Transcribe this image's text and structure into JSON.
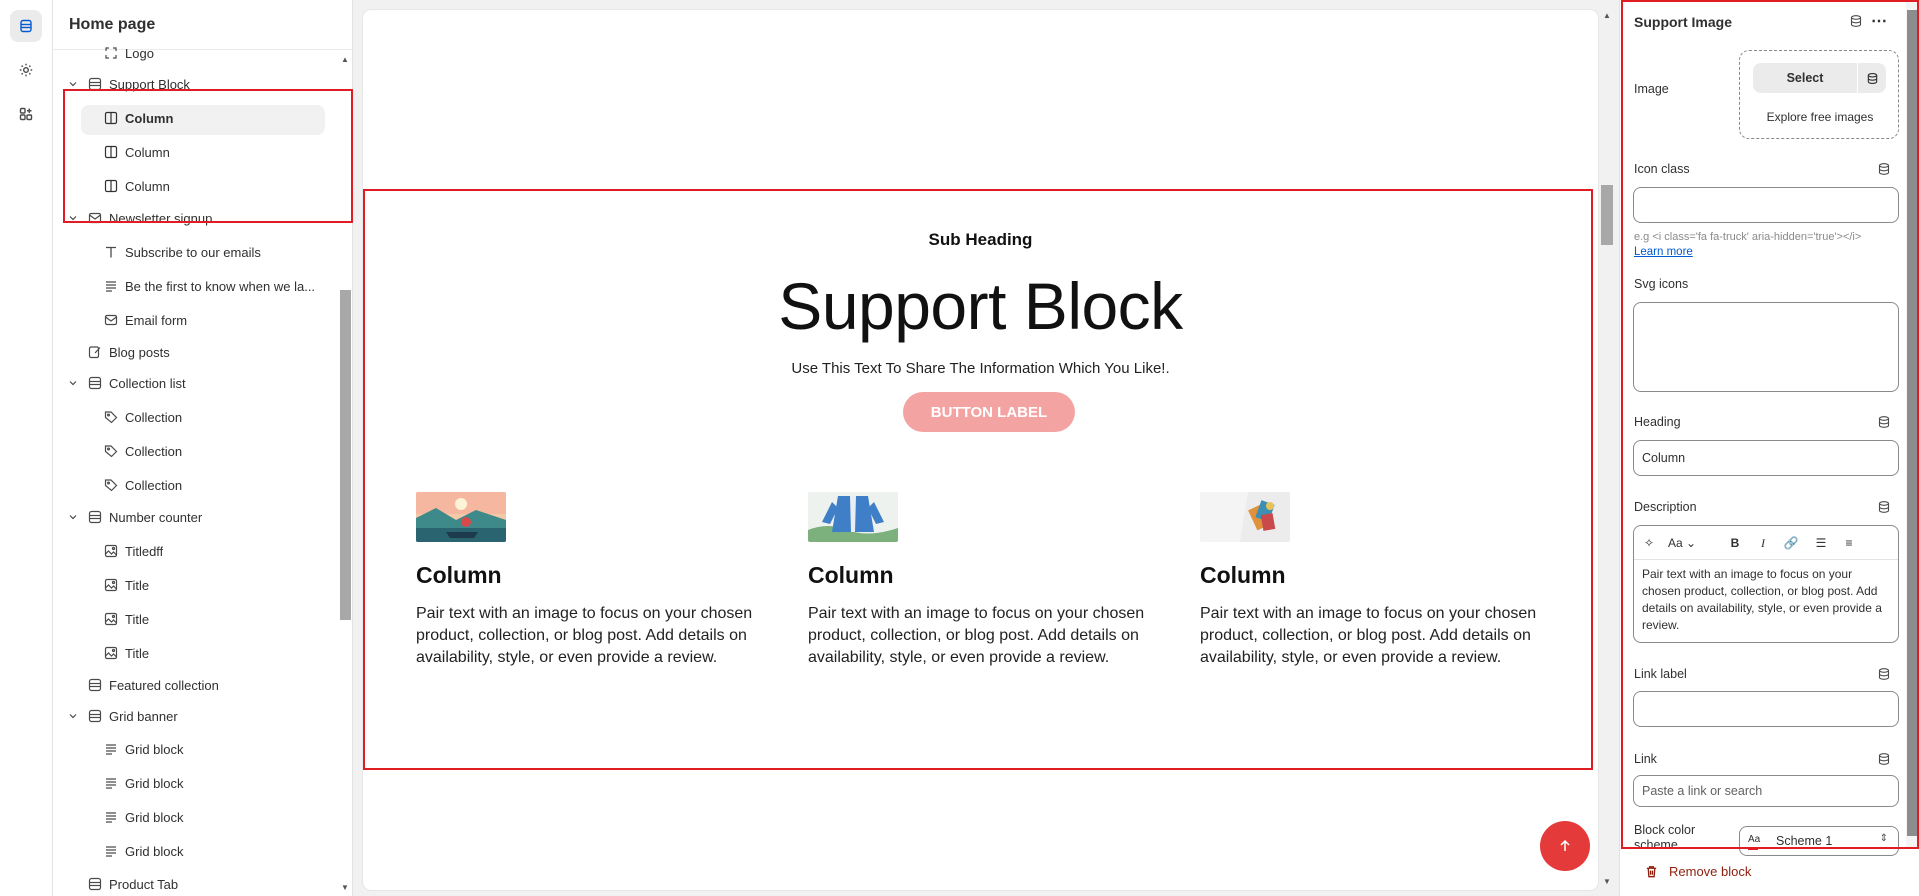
{
  "rail": {
    "items": [
      "sections-icon",
      "settings-icon",
      "apps-icon"
    ]
  },
  "sidebar": {
    "title": "Home page",
    "items": [
      {
        "label": "Logo",
        "level": 2,
        "icon": "logo-icon"
      },
      {
        "label": "Support Block",
        "level": 1,
        "icon": "section-icon",
        "expanded": true
      },
      {
        "label": "Column",
        "level": 2,
        "icon": "column-icon",
        "selected": true
      },
      {
        "label": "Column",
        "level": 2,
        "icon": "column-icon"
      },
      {
        "label": "Column",
        "level": 2,
        "icon": "column-icon"
      },
      {
        "label": "Newsletter signup",
        "level": 1,
        "icon": "email-icon",
        "expanded": true
      },
      {
        "label": "Subscribe to our emails",
        "level": 2,
        "icon": "text-icon"
      },
      {
        "label": "Be the first to know when we la...",
        "level": 2,
        "icon": "paragraph-icon"
      },
      {
        "label": "Email form",
        "level": 2,
        "icon": "email-icon"
      },
      {
        "label": "Blog posts",
        "level": 1,
        "icon": "blog-icon"
      },
      {
        "label": "Collection list",
        "level": 1,
        "icon": "section-icon",
        "expanded": true
      },
      {
        "label": "Collection",
        "level": 2,
        "icon": "tag-icon"
      },
      {
        "label": "Collection",
        "level": 2,
        "icon": "tag-icon"
      },
      {
        "label": "Collection",
        "level": 2,
        "icon": "tag-icon"
      },
      {
        "label": "Number counter",
        "level": 1,
        "icon": "section-icon",
        "expanded": true
      },
      {
        "label": "Titledff",
        "level": 2,
        "icon": "image-icon"
      },
      {
        "label": "Title",
        "level": 2,
        "icon": "image-icon"
      },
      {
        "label": "Title",
        "level": 2,
        "icon": "image-icon"
      },
      {
        "label": "Title",
        "level": 2,
        "icon": "image-icon"
      },
      {
        "label": "Featured collection",
        "level": 1,
        "icon": "section-icon"
      },
      {
        "label": "Grid banner",
        "level": 1,
        "icon": "section-icon",
        "expanded": true
      },
      {
        "label": "Grid block",
        "level": 2,
        "icon": "paragraph-icon"
      },
      {
        "label": "Grid block",
        "level": 2,
        "icon": "paragraph-icon"
      },
      {
        "label": "Grid block",
        "level": 2,
        "icon": "paragraph-icon"
      },
      {
        "label": "Grid block",
        "level": 2,
        "icon": "paragraph-icon"
      },
      {
        "label": "Product Tab",
        "level": 1,
        "icon": "section-icon"
      }
    ]
  },
  "preview": {
    "sub_heading": "Sub Heading",
    "heading": "Support Block",
    "text": "Use This Text To Share The Information Which You Like!.",
    "button_label": "BUTTON LABEL",
    "columns": [
      {
        "title": "Column",
        "description": "Pair text with an image to focus on your chosen product, collection, or blog post. Add details on availability, style, or even provide a review."
      },
      {
        "title": "Column",
        "description": "Pair text with an image to focus on your chosen product, collection, or blog post. Add details on availability, style, or even provide a review."
      },
      {
        "title": "Column",
        "description": "Pair text with an image to focus on your chosen product, collection, or blog post. Add details on availability, style, or even provide a review."
      }
    ],
    "scroll_top_icon": "arrow-up-icon"
  },
  "panel": {
    "title": "Support Image",
    "image_label": "Image",
    "select_label": "Select",
    "explore_label": "Explore free images",
    "icon_class_label": "Icon class",
    "icon_class_value": "",
    "icon_class_hint": "e.g <i class='fa fa-truck' aria-hidden='true'></i>",
    "learn_more": "Learn more",
    "svg_icons_label": "Svg icons",
    "heading_label": "Heading",
    "heading_value": "Column",
    "description_label": "Description",
    "description_value": "Pair text with an image to focus on your chosen product, collection, or blog post. Add details on availability, style, or even provide a review.",
    "link_label_label": "Link label",
    "link_label_value": "",
    "link_label": "Link",
    "link_placeholder": "Paste a link or search",
    "color_scheme_label": "Block color scheme",
    "color_scheme_value": "Scheme 1",
    "remove_label": "Remove block",
    "accent": "#e11d24"
  }
}
